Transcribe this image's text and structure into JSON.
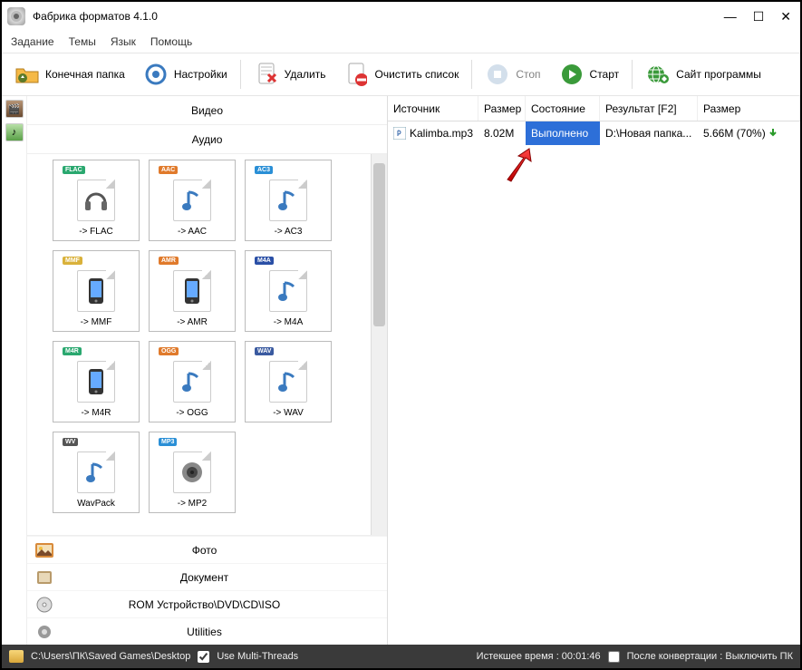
{
  "titlebar": {
    "title": "Фабрика форматов 4.1.0"
  },
  "menubar": {
    "items": [
      "Задание",
      "Темы",
      "Язык",
      "Помощь"
    ]
  },
  "toolbar": {
    "output_folder": "Конечная папка",
    "settings": "Настройки",
    "delete": "Удалить",
    "clear_list": "Очистить список",
    "stop": "Стоп",
    "start": "Старт",
    "website": "Сайт программы"
  },
  "categories": {
    "video": "Видео",
    "audio": "Аудио",
    "photo": "Фото",
    "document": "Документ",
    "rom": "ROM Устройство\\DVD\\CD\\ISO",
    "utilities": "Utilities"
  },
  "formats": [
    {
      "badge": "FLAC",
      "badge_color": "#2aa86f",
      "label": "-> FLAC",
      "glyph": "headset"
    },
    {
      "badge": "AAC",
      "badge_color": "#e07a2b",
      "label": "-> AAC",
      "glyph": "note"
    },
    {
      "badge": "AC3",
      "badge_color": "#2a8fd6",
      "label": "-> AC3",
      "glyph": "note"
    },
    {
      "badge": "MMF",
      "badge_color": "#d9b13a",
      "label": "-> MMF",
      "glyph": "phone"
    },
    {
      "badge": "AMR",
      "badge_color": "#e07a2b",
      "label": "-> AMR",
      "glyph": "phone"
    },
    {
      "badge": "M4A",
      "badge_color": "#2a4fa6",
      "label": "-> M4A",
      "glyph": "note"
    },
    {
      "badge": "M4R",
      "badge_color": "#2aa86f",
      "label": "-> M4R",
      "glyph": "phone"
    },
    {
      "badge": "OGG",
      "badge_color": "#e07a2b",
      "label": "-> OGG",
      "glyph": "note"
    },
    {
      "badge": "WAV",
      "badge_color": "#3a5aa0",
      "label": "-> WAV",
      "glyph": "note"
    },
    {
      "badge": "WV",
      "badge_color": "#555",
      "label": "WavPack",
      "glyph": "note"
    },
    {
      "badge": "MP3",
      "badge_color": "#2a8fd6",
      "label": "-> MP2",
      "glyph": "speaker"
    }
  ],
  "table": {
    "headers": {
      "source": "Источник",
      "size": "Размер",
      "state": "Состояние",
      "result": "Результат [F2]",
      "size2": "Размер"
    },
    "rows": [
      {
        "file": "Kalimba.mp3",
        "size": "8.02M",
        "state": "Выполнено",
        "result": "D:\\Новая папка...",
        "size2": "5.66M  (70%)"
      }
    ]
  },
  "status": {
    "path": "C:\\Users\\ПК\\Saved Games\\Desktop",
    "multithread": "Use Multi-Threads",
    "elapsed": "Истекшее время : 00:01:46",
    "after": "После конвертации : Выключить ПК"
  }
}
